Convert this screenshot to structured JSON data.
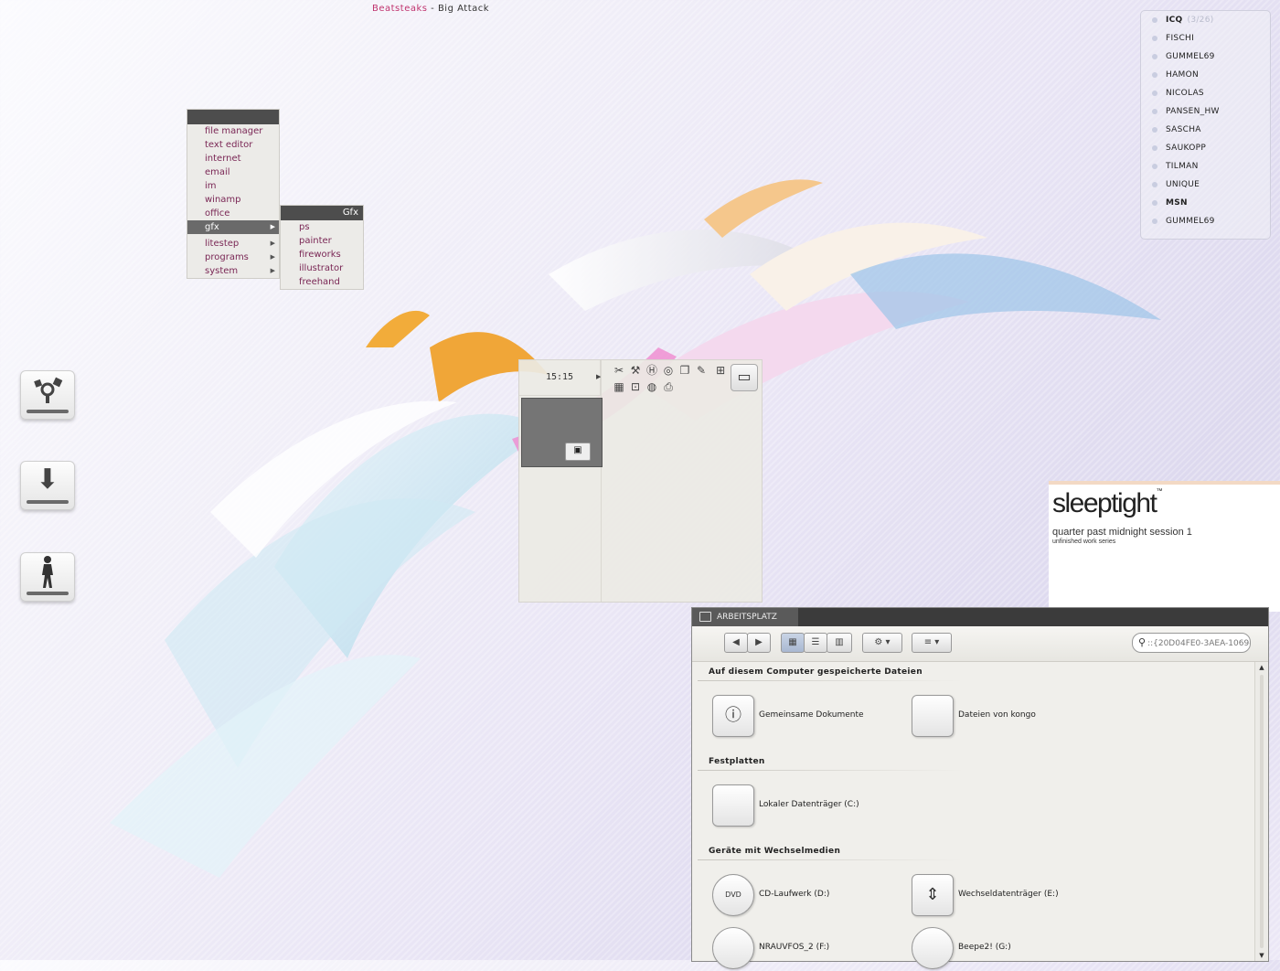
{
  "now_playing": {
    "artist": "Beatsteaks",
    "title": " - Big Attack"
  },
  "menu": {
    "items": [
      "file manager",
      "text editor",
      "internet",
      "email",
      "im",
      "winamp",
      "office",
      "gfx",
      "litestep",
      "programs",
      "system"
    ],
    "selected": "gfx",
    "submenu": {
      "title": "Gfx",
      "items": [
        "ps",
        "painter",
        "fireworks",
        "illustrator",
        "freehand"
      ]
    }
  },
  "buddies": {
    "icq": {
      "label": "ICQ",
      "count": "(3/26)"
    },
    "icq_items": [
      "FISCHI",
      "GUMMEL69",
      "HAMON",
      "NICOLAS",
      "PANSEN_HW",
      "SASCHA",
      "SAUKOPP",
      "TILMAN",
      "UNIQUE"
    ],
    "msn": {
      "label": "MSN"
    },
    "msn_items": [
      "GUMMEL69"
    ]
  },
  "desktop_icons": [
    "firewire-drive-icon",
    "download-drive-icon",
    "figure-drive-icon"
  ],
  "pager": {
    "clock": "15:15"
  },
  "brand": {
    "logo": "sleeptight",
    "tm": "™",
    "subtitle": "quarter past midnight session 1",
    "note": "unfinished work series"
  },
  "explorer": {
    "title": "ARBEITSPLATZ",
    "search_text": "::{20D04FE0-3AEA-1069-A2D8-08002B30309D}",
    "sections": {
      "files": "Auf diesem Computer gespeicherte Dateien",
      "disks": "Festplatten",
      "removable": "Geräte mit Wechselmedien"
    },
    "items": {
      "shared_docs": "Gemeinsame Dokumente",
      "kongo_files": "Dateien von kongo",
      "drive_c": "Lokaler Datenträger (C:)",
      "drive_d": "CD-Laufwerk (D:)",
      "drive_e": "Wechseldatenträger (E:)",
      "drive_f": "NRAUVFOS_2 (F:)",
      "drive_g": "Beepe2! (G:)"
    },
    "icons": {
      "dvd_label": "DVD"
    }
  },
  "colors": {
    "accent": "#c0336e",
    "menu_text": "#7a2755",
    "selected": "#6a6a6a",
    "titlebar": "#3b3b3b"
  }
}
